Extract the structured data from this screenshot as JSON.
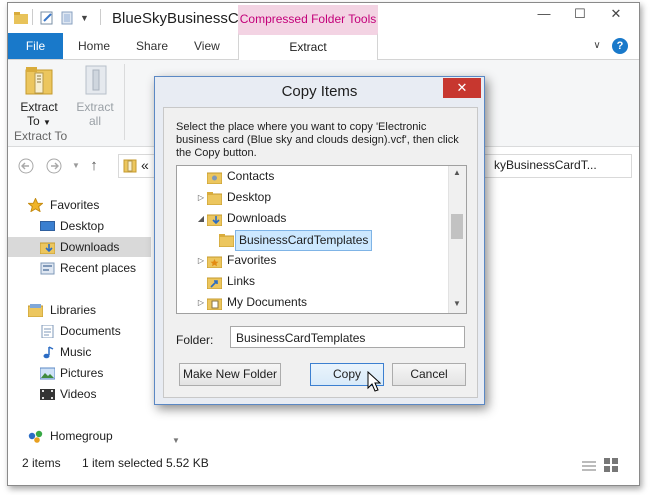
{
  "explorer": {
    "title": "BlueSkyBusinessC...",
    "contextual_tab": "Compressed Folder Tools",
    "tabs": [
      "File",
      "Home",
      "Share",
      "View",
      "Extract"
    ],
    "ribbon": {
      "extract_to_line1": "Extract",
      "extract_to_line2": "To",
      "extract_all_line1": "Extract",
      "extract_all_line2": "all",
      "group_label": "Extract To"
    },
    "address_prefix": "«",
    "address_tail": "kyBusinessCardT...",
    "sidebar": {
      "favorites": "Favorites",
      "desktop": "Desktop",
      "downloads": "Downloads",
      "recent": "Recent places",
      "libraries": "Libraries",
      "documents": "Documents",
      "music": "Music",
      "pictures": "Pictures",
      "videos": "Videos",
      "homegroup": "Homegroup"
    },
    "status": {
      "items": "2 items",
      "selected": "1 item selected",
      "size": "5.52 KB"
    }
  },
  "dialog": {
    "title": "Copy Items",
    "close": "✕",
    "description": "Select the place where you want to copy 'Electronic business card (Blue sky and clouds design).vcf', then click the Copy button.",
    "tree": [
      "Contacts",
      "Desktop",
      "Downloads",
      "BusinessCardTemplates",
      "Favorites",
      "Links",
      "My Documents"
    ],
    "folder_label": "Folder:",
    "folder_value": "BusinessCardTemplates",
    "buttons": {
      "make_new_folder": "Make New Folder",
      "copy": "Copy",
      "cancel": "Cancel"
    }
  },
  "colors": {
    "file_tab": "#1979ca",
    "context_tab_bg": "#f3d3e3",
    "context_tab_text": "#c3007a",
    "close_red": "#c7372f",
    "selection": "#cce8ff"
  }
}
